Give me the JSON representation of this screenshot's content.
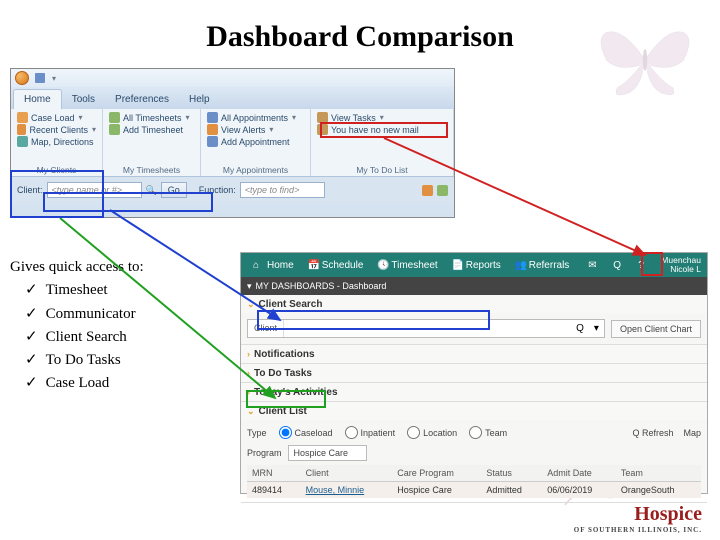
{
  "title": "Dashboard Comparison",
  "old_ui": {
    "tabs": [
      "Home",
      "Tools",
      "Preferences",
      "Help"
    ],
    "groups": [
      {
        "label": "My Clients",
        "items": [
          "Case Load",
          "Recent Clients",
          "Map, Directions"
        ]
      },
      {
        "label": "My Timesheets",
        "items": [
          "All Timesheets",
          "Add Timesheet"
        ]
      },
      {
        "label": "My Appointments",
        "items": [
          "All Appointments",
          "View Alerts",
          "Add Appointment"
        ]
      },
      {
        "label": "My To Do List",
        "items": [
          "View Tasks",
          "You have no new mail"
        ]
      }
    ],
    "search": {
      "client_label": "Client:",
      "client_placeholder": "<type name or #>",
      "go": "Go",
      "function_label": "Function:",
      "function_placeholder": "<type to find>"
    }
  },
  "text_block": {
    "heading": "Gives quick access to:",
    "items": [
      "Timesheet",
      "Communicator",
      "Client Search",
      "To Do Tasks",
      "Case Load"
    ]
  },
  "new_ui": {
    "nav": [
      "Home",
      "Schedule",
      "Timesheet",
      "Reports",
      "Referrals"
    ],
    "user": {
      "line1": "Muenchau",
      "line2": "Nicole L"
    },
    "dash_title": "MY DASHBOARDS - Dashboard",
    "panels": {
      "client_search": "Client Search",
      "notifications": "Notifications",
      "todo": "To Do Tasks",
      "activities": "Today's Activities",
      "client_list": "Client List"
    },
    "client_search_body": {
      "label": "Client",
      "chart_btn": "Open Client Chart"
    },
    "client_list": {
      "types": [
        "Caseload",
        "Inpatient",
        "Location",
        "Team"
      ],
      "refresh": "Refresh",
      "map": "Map",
      "type_label": "Type",
      "program_label": "Program",
      "program_value": "Hospice Care",
      "columns": [
        "MRN",
        "Client",
        "Care Program",
        "Status",
        "Admit Date",
        "Team"
      ],
      "row": {
        "mrn": "489414",
        "client": "Mouse, Minnie",
        "program": "Hospice Care",
        "status": "Admitted",
        "admit": "06/06/2019",
        "team": "OrangeSouth"
      }
    }
  },
  "logo": {
    "name": "Hospice",
    "sub": "OF SOUTHERN ILLINOIS, INC."
  }
}
